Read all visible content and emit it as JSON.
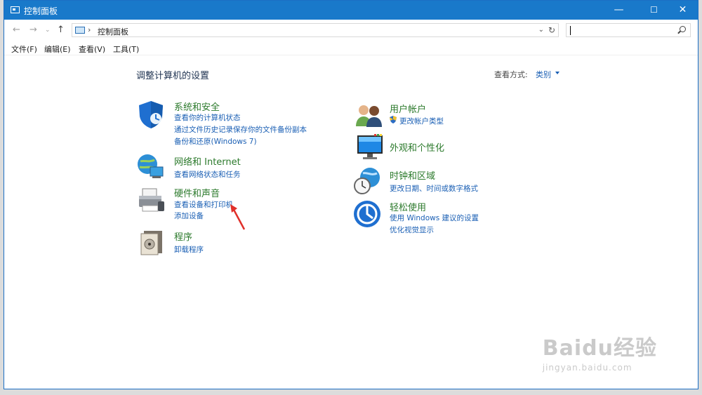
{
  "window": {
    "title": "控制面板",
    "controls": {
      "minimize": "—",
      "maximize": "☐",
      "close": "✕"
    }
  },
  "address": {
    "breadcrumb": "控制面板",
    "search_value": ""
  },
  "menu": {
    "items": [
      "文件(F)",
      "编辑(E)",
      "查看(V)",
      "工具(T)"
    ]
  },
  "main": {
    "title": "调整计算机的设置",
    "view_by_label": "查看方式:",
    "view_by_value": "类别"
  },
  "categories": {
    "system": {
      "title": "系统和安全",
      "links": [
        "查看你的计算机状态",
        "通过文件历史记录保存你的文件备份副本",
        "备份和还原(Windows 7)"
      ]
    },
    "network": {
      "title": "网络和 Internet",
      "links": [
        "查看网络状态和任务"
      ]
    },
    "hardware": {
      "title": "硬件和声音",
      "links": [
        "查看设备和打印机",
        "添加设备"
      ]
    },
    "programs": {
      "title": "程序",
      "links": [
        "卸载程序"
      ]
    },
    "accounts": {
      "title": "用户帐户",
      "links": [
        "更改帐户类型"
      ]
    },
    "appearance": {
      "title": "外观和个性化",
      "links": []
    },
    "clock": {
      "title": "时钟和区域",
      "links": [
        "更改日期、时间或数字格式"
      ]
    },
    "ease": {
      "title": "轻松使用",
      "links": [
        "使用 Windows 建议的设置",
        "优化视觉显示"
      ]
    }
  },
  "watermark": {
    "main": "Baidu经验",
    "sub": "jingyan.baidu.com"
  },
  "colors": {
    "accent": "#1979ca",
    "link": "#1a5fb4",
    "category": "#2c7a2c",
    "arrow": "#e0302a"
  }
}
